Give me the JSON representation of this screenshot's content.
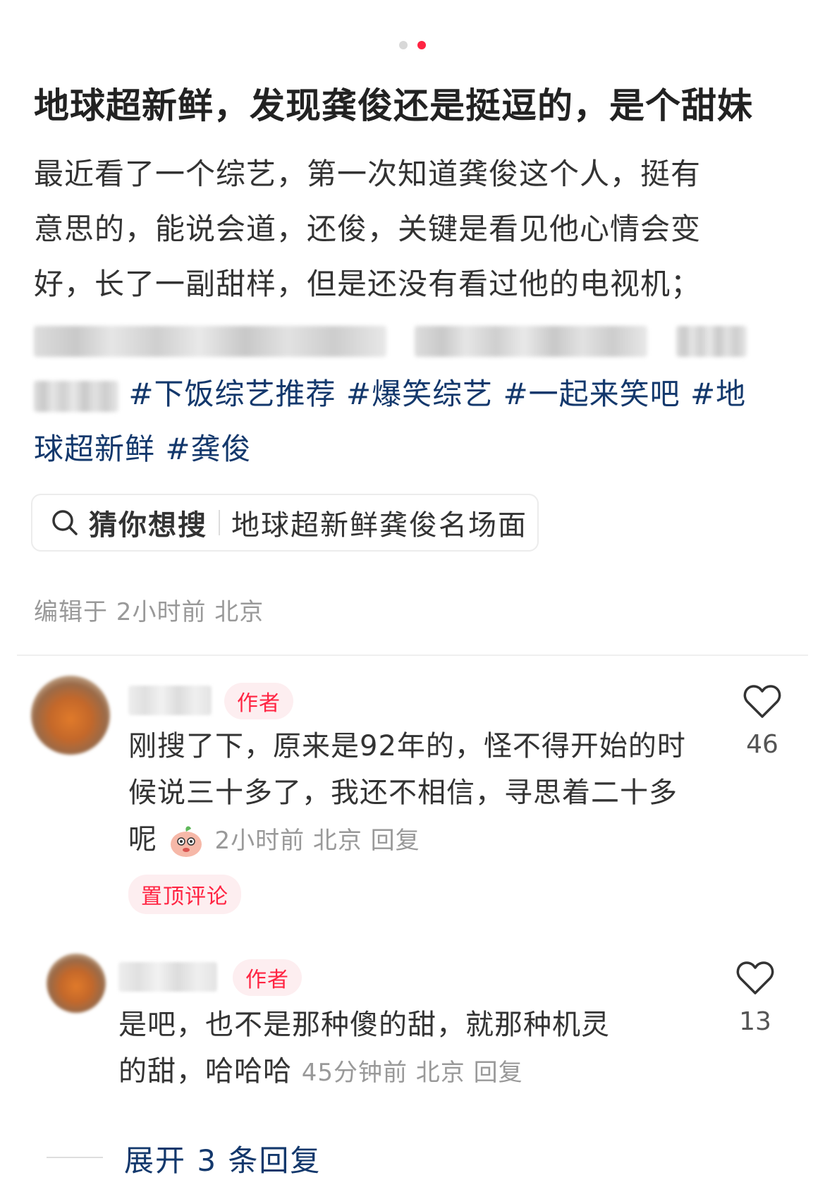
{
  "pager": {
    "count": 2,
    "active_index": 1
  },
  "post": {
    "title": "地球超新鲜，发现龚俊还是挺逗的，是个甜妹",
    "body_lines": [
      "最近看了一个综艺，第一次知道龚俊这个人，挺有",
      "意思的，能说会道，还俊，关键是看见他心情会变",
      "好，长了一副甜样，但是还没有看过他的电视机；"
    ],
    "tags_line1": "#下饭综艺推荐 #爆笑综艺 #一起来笑吧 #地",
    "tags_line2": "球超新鲜 #龚俊",
    "meta": "编辑于 2小时前 北京"
  },
  "search": {
    "prefix": "猜你想搜",
    "query": "地球超新鲜龚俊名场面"
  },
  "comments": [
    {
      "badge": "作者",
      "text_line1": "刚搜了下，原来是92年的，怪不得开始的时",
      "text_line2": "候说三十多了，我还不相信，寻思着二十多",
      "text_line3": "呢",
      "meta": "2小时前 北京 回复",
      "pin_label": "置顶评论",
      "likes": "46"
    },
    {
      "badge": "作者",
      "text_line1": "是吧，也不是那种傻的甜，就那种机灵",
      "text_line2": "的甜，哈哈哈",
      "meta": "45分钟前 北京 回复",
      "likes": "13"
    }
  ],
  "expand_label": "展开 3 条回复",
  "colors": {
    "accent": "#ff2442",
    "tag": "#13386c",
    "muted": "#999999"
  }
}
